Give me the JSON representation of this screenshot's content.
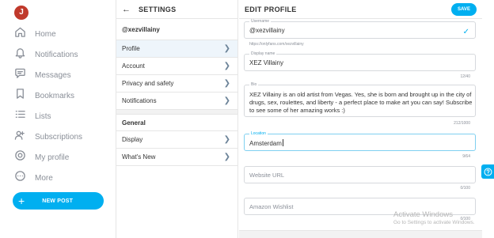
{
  "user": {
    "avatar_initial": "J"
  },
  "nav": {
    "items": [
      {
        "label": "Home",
        "icon": "home-icon"
      },
      {
        "label": "Notifications",
        "icon": "bell-icon"
      },
      {
        "label": "Messages",
        "icon": "message-icon"
      },
      {
        "label": "Bookmarks",
        "icon": "bookmark-icon"
      },
      {
        "label": "Lists",
        "icon": "list-icon"
      },
      {
        "label": "Subscriptions",
        "icon": "subscriptions-icon"
      },
      {
        "label": "My profile",
        "icon": "profile-icon"
      },
      {
        "label": "More",
        "icon": "more-icon"
      }
    ],
    "new_post": "NEW POST"
  },
  "settings": {
    "title": "SETTINGS",
    "back_icon": "arrow-left-icon",
    "username": "@xezvillainy",
    "items": [
      {
        "label": "Profile"
      },
      {
        "label": "Account"
      },
      {
        "label": "Privacy and safety"
      },
      {
        "label": "Notifications"
      }
    ],
    "general_label": "General",
    "general_items": [
      {
        "label": "Display"
      },
      {
        "label": "What's New"
      }
    ]
  },
  "edit_profile": {
    "title": "EDIT PROFILE",
    "save_label": "SAVE",
    "username": {
      "label": "Username",
      "value": "@xezvillainy",
      "hint": "https://onlyfans.com/xezvillainy"
    },
    "display_name": {
      "label": "Display name",
      "value": "XEZ Villainy",
      "counter": "12/40"
    },
    "bio": {
      "label": "Bio",
      "value": "XEZ Villainy is an old artist from Vegas. Yes, she is born and brought up in the city of drugs, sex, roulettes, and liberty - a perfect place to make art you can say! Subscribe to see some of her amazing works :)",
      "counter": "212/1000"
    },
    "location": {
      "label": "Location",
      "value": "Amsterdam",
      "counter": "9/64"
    },
    "website": {
      "placeholder": "Website URL",
      "counter": "0/100"
    },
    "wishlist": {
      "placeholder": "Amazon Wishlist",
      "counter": "0/100"
    }
  },
  "watermark": {
    "line1": "Activate Windows",
    "line2": "Go to Settings to activate Windows."
  },
  "colors": {
    "accent": "#00aff0",
    "avatar": "#c0392b",
    "icon_gray": "#8a8f98"
  }
}
